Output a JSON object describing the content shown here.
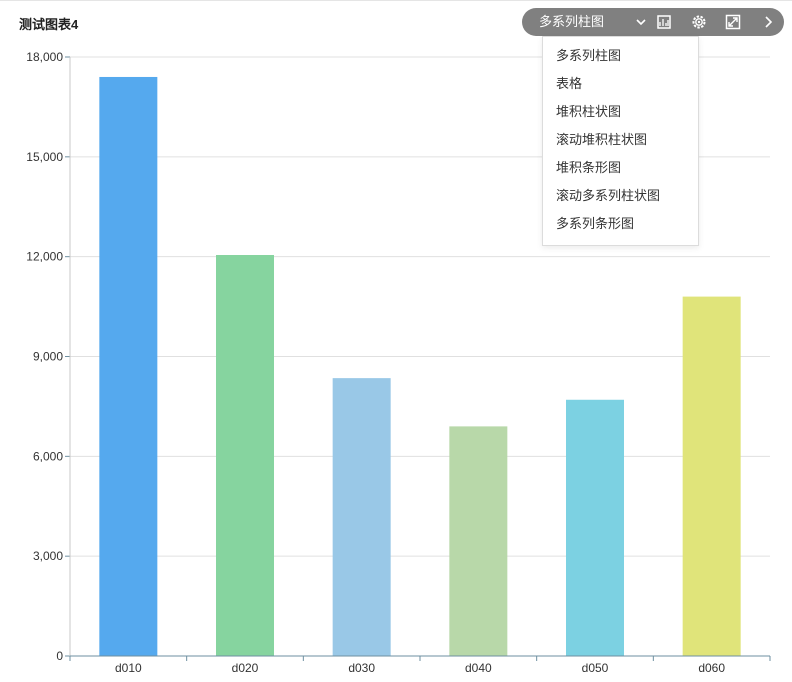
{
  "title": "测试图表4",
  "toolbar": {
    "chart_type_label": "多系列柱图",
    "icons": [
      "chevron-down-icon",
      "export-image-icon",
      "settings-icon",
      "fullscreen-icon",
      "chevron-right-icon"
    ]
  },
  "dropdown": {
    "items": [
      "多系列柱图",
      "表格",
      "堆积柱状图",
      "滚动堆积柱状图",
      "堆积条形图",
      "滚动多系列柱状图",
      "多系列条形图"
    ]
  },
  "chart_data": {
    "type": "bar",
    "categories": [
      "d010",
      "d020",
      "d030",
      "d040",
      "d050",
      "d060"
    ],
    "values": [
      17400,
      12050,
      8350,
      6900,
      7700,
      10800
    ],
    "colors": [
      "#55a9ee",
      "#86d49f",
      "#99c8e7",
      "#b8d8a9",
      "#7cd1e2",
      "#e0e47a"
    ],
    "yticks": [
      "0",
      "3,000",
      "6,000",
      "9,000",
      "12,000",
      "15,000",
      "18,000"
    ],
    "ylim": [
      0,
      18000
    ],
    "grid": true
  }
}
